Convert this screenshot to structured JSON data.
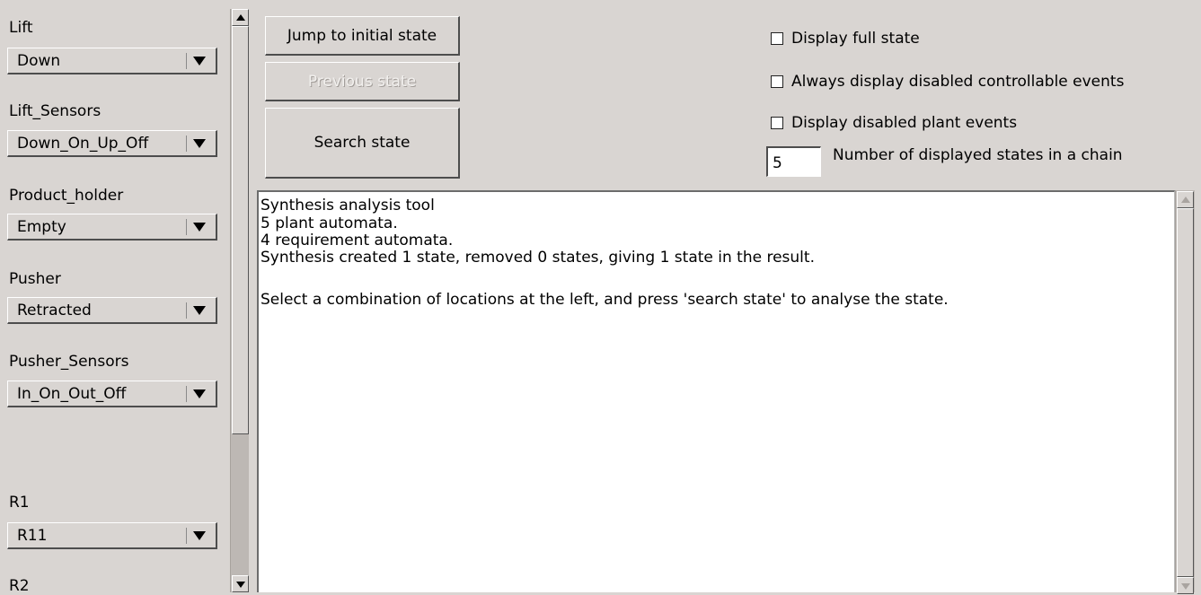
{
  "left_panel": {
    "groups": [
      {
        "label": "Lift",
        "value": "Down"
      },
      {
        "label": "Lift_Sensors",
        "value": "Down_On_Up_Off"
      },
      {
        "label": "Product_holder",
        "value": "Empty"
      },
      {
        "label": "Pusher",
        "value": "Retracted"
      },
      {
        "label": "Pusher_Sensors",
        "value": "In_On_Out_Off"
      },
      {
        "label": "R1",
        "value": "R11"
      },
      {
        "label": "R2",
        "value": ""
      }
    ]
  },
  "buttons": {
    "jump_initial": "Jump to initial state",
    "previous": "Previous state",
    "search": "Search state"
  },
  "options": {
    "display_full_state": {
      "label": "Display full state",
      "checked": false
    },
    "always_display_disabled_controllable": {
      "label": "Always display disabled controllable events",
      "checked": false
    },
    "display_disabled_plant": {
      "label": "Display disabled plant events",
      "checked": false
    }
  },
  "chain": {
    "value": "5",
    "label": "Number of displayed states in a chain"
  },
  "output": {
    "lines": [
      "Synthesis analysis tool",
      "5 plant automata.",
      "4 requirement automata.",
      "Synthesis created 1 state, removed 0 states, giving 1 state in the result.",
      "",
      "Select a combination of locations at the left, and press 'search state' to analyse the state."
    ]
  }
}
